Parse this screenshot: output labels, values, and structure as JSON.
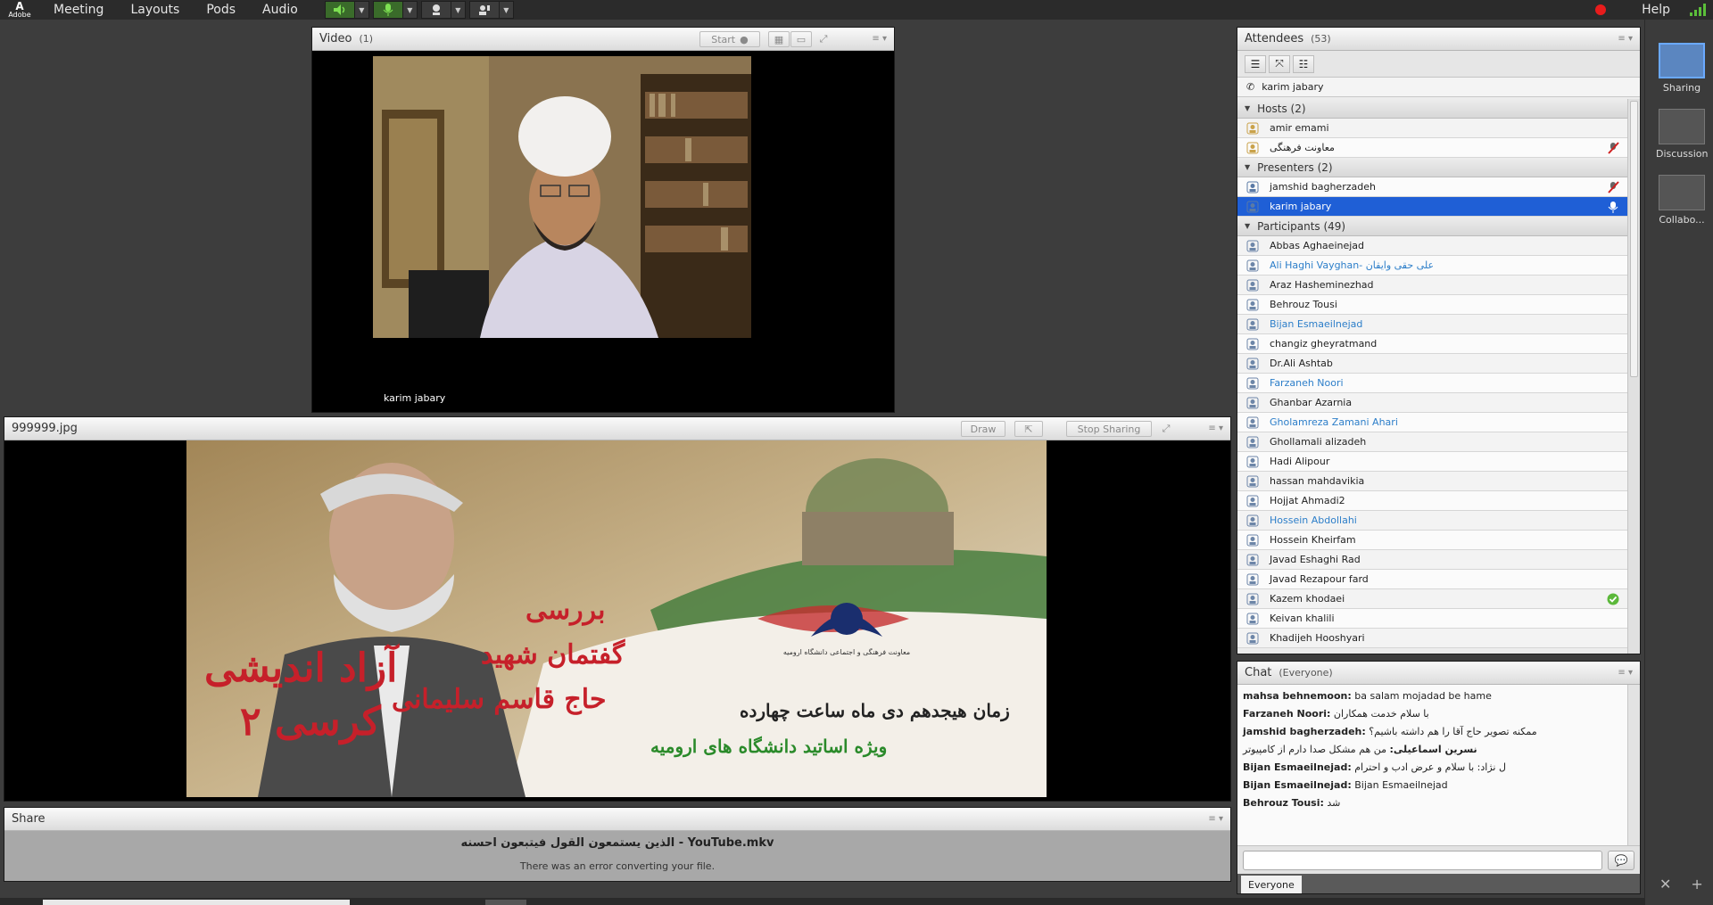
{
  "app": {
    "logo_text": "Adobe"
  },
  "menu": [
    "Meeting",
    "Layouts",
    "Pods",
    "Audio"
  ],
  "help_label": "Help",
  "video_pod": {
    "title": "Video",
    "count": "(1)",
    "start_label": "Start",
    "speaker_name": "karim jabary"
  },
  "share_pod": {
    "title": "999999.jpg",
    "draw_label": "Draw",
    "stop_sharing_label": "Stop Sharing"
  },
  "share_doc_pod": {
    "title": "Share",
    "file_title": "الذین یستمعون القول فیتبعون احسنه - YouTube.mkv",
    "error": "There was an error converting your file."
  },
  "attendees": {
    "title": "Attendees",
    "count": "(53)",
    "me": "karim jabary",
    "groups": [
      {
        "label": "Hosts (2)",
        "rows": [
          {
            "name": "amir emami",
            "blue": false,
            "state": ""
          },
          {
            "name": "ﻣﻌﺎﻭﻧﺖ ﻓﺮﻫﻨﮕﯽ",
            "blue": false,
            "state": "mic-off"
          }
        ]
      },
      {
        "label": "Presenters (2)",
        "rows": [
          {
            "name": "jamshid bagherzadeh",
            "blue": false,
            "state": "mic-off"
          },
          {
            "name": "karim jabary",
            "blue": false,
            "state": "mic-on",
            "selected": true
          }
        ]
      },
      {
        "label": "Participants (49)",
        "rows": [
          {
            "name": "Abbas Aghaeinejad",
            "blue": false,
            "state": ""
          },
          {
            "name": "Ali Haghi Vayghan- علی حقی وایقان",
            "blue": true,
            "state": ""
          },
          {
            "name": "Araz Hasheminezhad",
            "blue": false,
            "state": ""
          },
          {
            "name": "Behrouz Tousi",
            "blue": false,
            "state": ""
          },
          {
            "name": "Bijan Esmaeilnejad",
            "blue": true,
            "state": ""
          },
          {
            "name": "changiz gheyratmand",
            "blue": false,
            "state": ""
          },
          {
            "name": "Dr.Ali Ashtab",
            "blue": false,
            "state": ""
          },
          {
            "name": "Farzaneh Noori",
            "blue": true,
            "state": ""
          },
          {
            "name": "Ghanbar Azarnia",
            "blue": false,
            "state": ""
          },
          {
            "name": "Gholamreza Zamani Ahari",
            "blue": true,
            "state": ""
          },
          {
            "name": "Ghollamali alizadeh",
            "blue": false,
            "state": ""
          },
          {
            "name": "Hadi Alipour",
            "blue": false,
            "state": ""
          },
          {
            "name": "hassan mahdavikia",
            "blue": false,
            "state": ""
          },
          {
            "name": "Hojjat Ahmadi2",
            "blue": false,
            "state": ""
          },
          {
            "name": "Hossein Abdollahi",
            "blue": true,
            "state": ""
          },
          {
            "name": "Hossein Kheirfam",
            "blue": false,
            "state": ""
          },
          {
            "name": "Javad Eshaghi Rad",
            "blue": false,
            "state": ""
          },
          {
            "name": "Javad Rezapour fard",
            "blue": false,
            "state": ""
          },
          {
            "name": "Kazem khodaei",
            "blue": false,
            "state": "agree"
          },
          {
            "name": "Keivan khalili",
            "blue": false,
            "state": ""
          },
          {
            "name": "Khadijeh Hooshyari",
            "blue": false,
            "state": ""
          }
        ]
      }
    ]
  },
  "chat": {
    "title": "Chat",
    "scope": "(Everyone)",
    "messages": [
      {
        "sender": "mahsa behnemoon:",
        "text": "ba salam mojadad be hame"
      },
      {
        "sender": "Farzaneh Noori:",
        "text": "با سلام خدمت همکاران"
      },
      {
        "sender": "jamshid bagherzadeh:",
        "text": "ممکنه تصویر حاج آقا را هم داشته باشیم؟"
      },
      {
        "sender": "نسرین اسماعیلی:",
        "text": "من هم مشکل صدا دارم از کامپیوتر"
      },
      {
        "sender": "Bijan Esmaeilnejad:",
        "text": "ل نژاد: با سلام و عرض ادب و احترام"
      },
      {
        "sender": "Bijan Esmaeilnejad:",
        "text": "Bijan Esmaeilnejad"
      },
      {
        "sender": "Behrouz Tousi:",
        "text": "شد"
      }
    ],
    "tab": "Everyone"
  },
  "layouts": [
    {
      "label": "Sharing",
      "active": true
    },
    {
      "label": "Discussion",
      "active": false
    },
    {
      "label": "Collabo...",
      "active": false
    }
  ]
}
